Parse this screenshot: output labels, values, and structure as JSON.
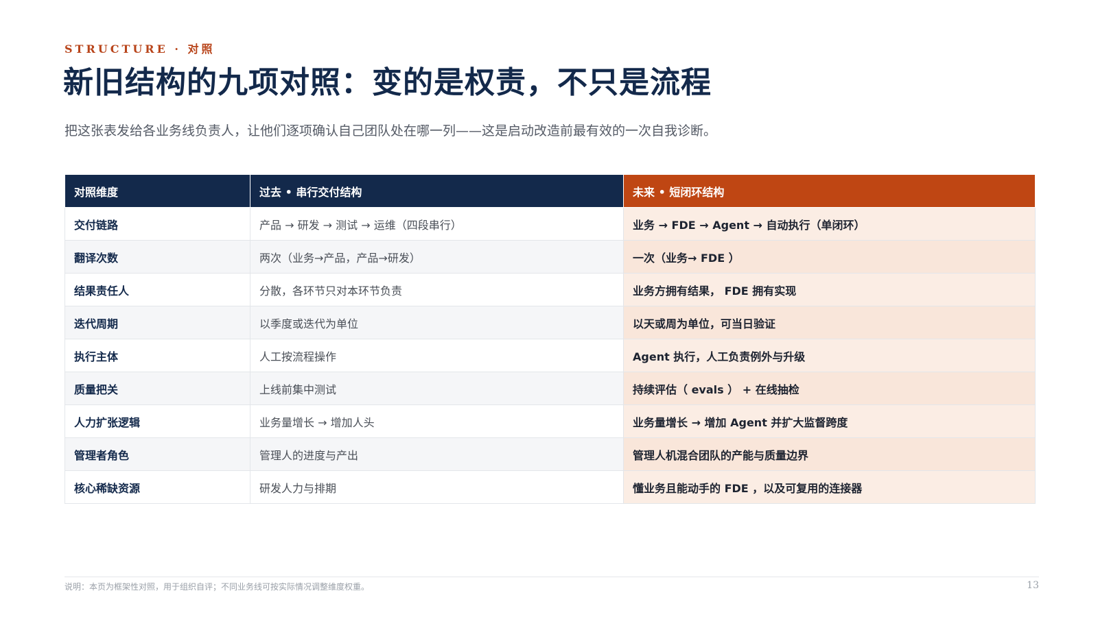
{
  "header": {
    "kicker": "STRUCTURE · 对照",
    "title": "新旧结构的九项对照：变的是权责，不只是流程",
    "subtitle": "把这张表发给各业务线负责人，让他们逐项确认自己团队处在哪一列——这是启动改造前最有效的一次自我诊断。"
  },
  "table": {
    "headers": {
      "dimension": "对照维度",
      "past": "过去 • 串行交付结构",
      "future": "未来 • 短闭环结构"
    },
    "rows": [
      {
        "dimension": "交付链路",
        "past": "产品 → 研发 → 测试 → 运维（四段串行）",
        "future": "业务 → FDE → Agent → 自动执行（单闭环）"
      },
      {
        "dimension": "翻译次数",
        "past": "两次（业务→产品，产品→研发）",
        "future": "一次（业务→ FDE ）"
      },
      {
        "dimension": "结果责任人",
        "past": "分散，各环节只对本环节负责",
        "future": "业务方拥有结果， FDE 拥有实现"
      },
      {
        "dimension": "迭代周期",
        "past": "以季度或迭代为单位",
        "future": "以天或周为单位，可当日验证"
      },
      {
        "dimension": "执行主体",
        "past": "人工按流程操作",
        "future": "Agent 执行，人工负责例外与升级"
      },
      {
        "dimension": "质量把关",
        "past": "上线前集中测试",
        "future": "持续评估（ evals ） + 在线抽检"
      },
      {
        "dimension": "人力扩张逻辑",
        "past": "业务量增长 → 增加人头",
        "future": "业务量增长 → 增加 Agent 并扩大监督跨度"
      },
      {
        "dimension": "管理者角色",
        "past": "管理人的进度与产出",
        "future": "管理人机混合团队的产能与质量边界"
      },
      {
        "dimension": "核心稀缺资源",
        "past": "研发人力与排期",
        "future": "懂业务且能动手的 FDE ，以及可复用的连接器"
      }
    ]
  },
  "footer": {
    "note": "说明：本页为框架性对照，用于组织自评；不同业务线可按实际情况调整维度权重。",
    "page_number": "13"
  },
  "colors": {
    "navy": "#13294B",
    "accent_orange": "#BF4613",
    "future_tint": "#FBEDE4"
  }
}
